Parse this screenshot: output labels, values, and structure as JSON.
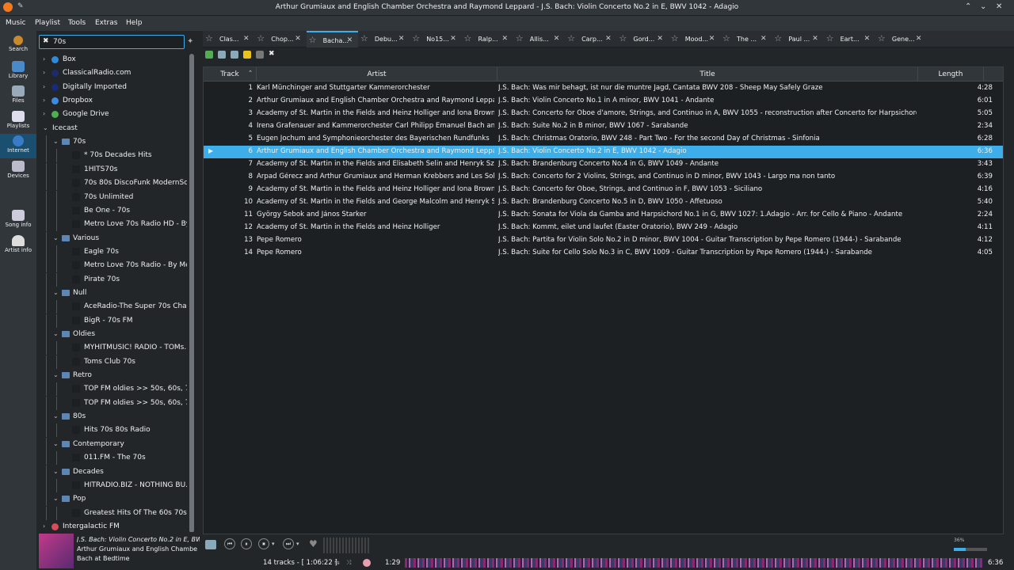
{
  "window": {
    "title": "Arthur Grumiaux and English Chamber Orchestra and Raymond Leppard - J.S. Bach: Violin Concerto No.2 in E, BWV 1042 - Adagio"
  },
  "menu": [
    "Music",
    "Playlist",
    "Tools",
    "Extras",
    "Help"
  ],
  "nav": [
    "Search",
    "Library",
    "Files",
    "Playlists",
    "Internet",
    "Devices",
    "Song info",
    "Artist info"
  ],
  "nav_selected": "Internet",
  "search": {
    "value": "70s"
  },
  "tree": [
    {
      "label": "Box",
      "depth": 0,
      "expand": "closed",
      "icon": "box-icon"
    },
    {
      "label": "ClassicalRadio.com",
      "depth": 0,
      "expand": "closed",
      "icon": "classicalradio-icon"
    },
    {
      "label": "Digitally Imported",
      "depth": 0,
      "expand": "closed",
      "icon": "di-icon"
    },
    {
      "label": "Dropbox",
      "depth": 0,
      "expand": "closed",
      "icon": "dropbox-icon"
    },
    {
      "label": "Google Drive",
      "depth": 0,
      "expand": "closed",
      "icon": "google-drive-icon"
    },
    {
      "label": "Icecast",
      "depth": 0,
      "expand": "open",
      "icon": ""
    },
    {
      "label": "70s",
      "depth": 1,
      "expand": "open",
      "icon": "folder-icon"
    },
    {
      "label": "* 70s Decades Hits",
      "depth": 2
    },
    {
      "label": "1HITS70s",
      "depth": 2
    },
    {
      "label": "70s 80s DiscoFunk ModernSo...",
      "depth": 2
    },
    {
      "label": "70s Unlimited",
      "depth": 2
    },
    {
      "label": "Be One - 70s",
      "depth": 2
    },
    {
      "label": "Metro Love 70s Radio HD - By...",
      "depth": 2
    },
    {
      "label": "Various",
      "depth": 1,
      "expand": "open",
      "icon": "folder-icon"
    },
    {
      "label": "Eagle 70s",
      "depth": 2
    },
    {
      "label": "Metro Love 70s Radio - By Me...",
      "depth": 2
    },
    {
      "label": "Pirate 70s",
      "depth": 2
    },
    {
      "label": "Null",
      "depth": 1,
      "expand": "open",
      "icon": "folder-icon"
    },
    {
      "label": "AceRadio-The Super 70s Cha...",
      "depth": 2
    },
    {
      "label": "BigR - 70s FM",
      "depth": 2
    },
    {
      "label": "Oldies",
      "depth": 1,
      "expand": "open",
      "icon": "folder-icon"
    },
    {
      "label": "MYHITMUSIC!  RADIO - TOMs...",
      "depth": 2
    },
    {
      "label": "Toms Club 70s",
      "depth": 2
    },
    {
      "label": "Retro",
      "depth": 1,
      "expand": "open",
      "icon": "folder-icon"
    },
    {
      "label": "TOP FM oldies >> 50s, 60s, 70...",
      "depth": 2
    },
    {
      "label": "TOP FM oldies >> 50s, 60s, 70...",
      "depth": 2
    },
    {
      "label": "80s",
      "depth": 1,
      "expand": "open",
      "icon": "folder-icon"
    },
    {
      "label": "Hits 70s 80s Radio",
      "depth": 2
    },
    {
      "label": "Contemporary",
      "depth": 1,
      "expand": "open",
      "icon": "folder-icon"
    },
    {
      "label": "011.FM - The 70s",
      "depth": 2
    },
    {
      "label": "Decades",
      "depth": 1,
      "expand": "open",
      "icon": "folder-icon"
    },
    {
      "label": "HITRADIO.BIZ - NOTHING BU...",
      "depth": 2
    },
    {
      "label": "Pop",
      "depth": 1,
      "expand": "open",
      "icon": "folder-icon"
    },
    {
      "label": "Greatest Hits Of The 60s 70s ...",
      "depth": 2
    },
    {
      "label": "Intergalactic FM",
      "depth": 0,
      "expand": "closed",
      "icon": "intergalactic-icon"
    }
  ],
  "now_playing": {
    "title": "J.S. Bach: Violin Concerto No.2 in E, BWV",
    "artist": "Arthur Grumiaux and English Chambe",
    "album": "Bach at Bedtime"
  },
  "tabs": [
    {
      "label": "Clas..."
    },
    {
      "label": "Chop..."
    },
    {
      "label": "Bacha...",
      "active": true
    },
    {
      "label": "Debu..."
    },
    {
      "label": "No15..."
    },
    {
      "label": "Ralp..."
    },
    {
      "label": "Allis..."
    },
    {
      "label": "Carp..."
    },
    {
      "label": "Gord..."
    },
    {
      "label": "Mood..."
    },
    {
      "label": "The ..."
    },
    {
      "label": "Paul ..."
    },
    {
      "label": "Eart..."
    },
    {
      "label": "Gene..."
    }
  ],
  "columns": {
    "track": "Track",
    "artist": "Artist",
    "title": "Title",
    "length": "Length"
  },
  "tracks": [
    {
      "n": "1",
      "artist": "Karl Münchinger and Stuttgarter Kammerorchester",
      "title": "J.S. Bach: Was mir behagt, ist nur die muntre Jagd, Cantata BWV 208 - Sheep May Safely Graze",
      "length": "4:28"
    },
    {
      "n": "2",
      "artist": "Arthur Grumiaux and English Chamber Orchestra and Raymond Leppard",
      "title": "J.S. Bach: Violin Concerto No.1 in A minor, BWV 1041 - Andante",
      "length": "6:01"
    },
    {
      "n": "3",
      "artist": "Academy of St. Martin in the Fields and Heinz Holliger and Iona Brown",
      "title": "J.S. Bach: Concerto for Oboe d'amore, Strings, and Continuo in A, BWV 1055 - reconstruction after Concerto for Harpsichord, Stri...",
      "length": "5:05"
    },
    {
      "n": "4",
      "artist": "Irena Grafenauer and Kammerorchester Carl Philipp Emanuel Bach and ...",
      "title": "J.S. Bach: Suite No.2 in B minor, BWV 1067 - Sarabande",
      "length": "2:34"
    },
    {
      "n": "5",
      "artist": "Eugen Jochum and Symphonieorchester des Bayerischen Rundfunks",
      "title": "J.S. Bach: Christmas Oratorio, BWV 248 - Part Two - For the second Day of Christmas - Sinfonia",
      "length": "6:28"
    },
    {
      "n": "6",
      "artist": "Arthur Grumiaux and English Chamber Orchestra and Raymond Leppard",
      "title": "J.S. Bach: Violin Concerto No.2 in E, BWV 1042 - Adagio",
      "length": "6:36",
      "playing": true
    },
    {
      "n": "7",
      "artist": "Academy of St. Martin in the Fields and Elisabeth Selin and Henryk Szery...",
      "title": "J.S. Bach: Brandenburg Concerto No.4 in G, BWV 1049 - Andante",
      "length": "3:43"
    },
    {
      "n": "8",
      "artist": "Arpad Gérecz and Arthur Grumiaux and Herman Krebbers and Les Solist...",
      "title": "J.S. Bach: Concerto for 2 Violins, Strings, and Continuo in D minor, BWV 1043 - Largo ma non tanto",
      "length": "6:39"
    },
    {
      "n": "9",
      "artist": "Academy of St. Martin in the Fields and Heinz Holliger and Iona Brown",
      "title": "J.S. Bach: Concerto for Oboe, Strings, and Continuo in F, BWV 1053 - Siciliano",
      "length": "4:16"
    },
    {
      "n": "10",
      "artist": "Academy of St. Martin in the Fields and George Malcolm and Henryk Sze...",
      "title": "J.S. Bach: Brandenburg Concerto No.5 in D, BWV 1050 - Affetuoso",
      "length": "5:40"
    },
    {
      "n": "11",
      "artist": "György Sebok and János Starker",
      "title": "J.S. Bach: Sonata for Viola da Gamba and Harpsichord No.1 in G, BWV 1027: 1.Adagio - Arr. for Cello & Piano - Andante",
      "length": "2:24"
    },
    {
      "n": "12",
      "artist": "Academy of St. Martin in the Fields and Heinz Holliger",
      "title": "J.S. Bach: Kommt, eilet und laufet (Easter Oratorio), BWV 249 - Adagio",
      "length": "4:11"
    },
    {
      "n": "13",
      "artist": "Pepe Romero",
      "title": "J.S. Bach: Partita for Violin Solo No.2 in D minor, BWV 1004 - Guitar Transcription by Pepe Romero (1944-) - Sarabande",
      "length": "4:12"
    },
    {
      "n": "14",
      "artist": "Pepe Romero",
      "title": "J.S. Bach: Suite for Cello Solo No.3 in C, BWV 1009 - Guitar Transcription by Pepe Romero (1944-) - Sarabande",
      "length": "4:05"
    }
  ],
  "status": {
    "tracks": "14 tracks - [ 1:06:22 ]",
    "position": "1:29",
    "duration": "6:36",
    "volume": "36%"
  },
  "colors": {
    "accent": "#3daee9",
    "window": "#31363b",
    "base": "#232629"
  }
}
